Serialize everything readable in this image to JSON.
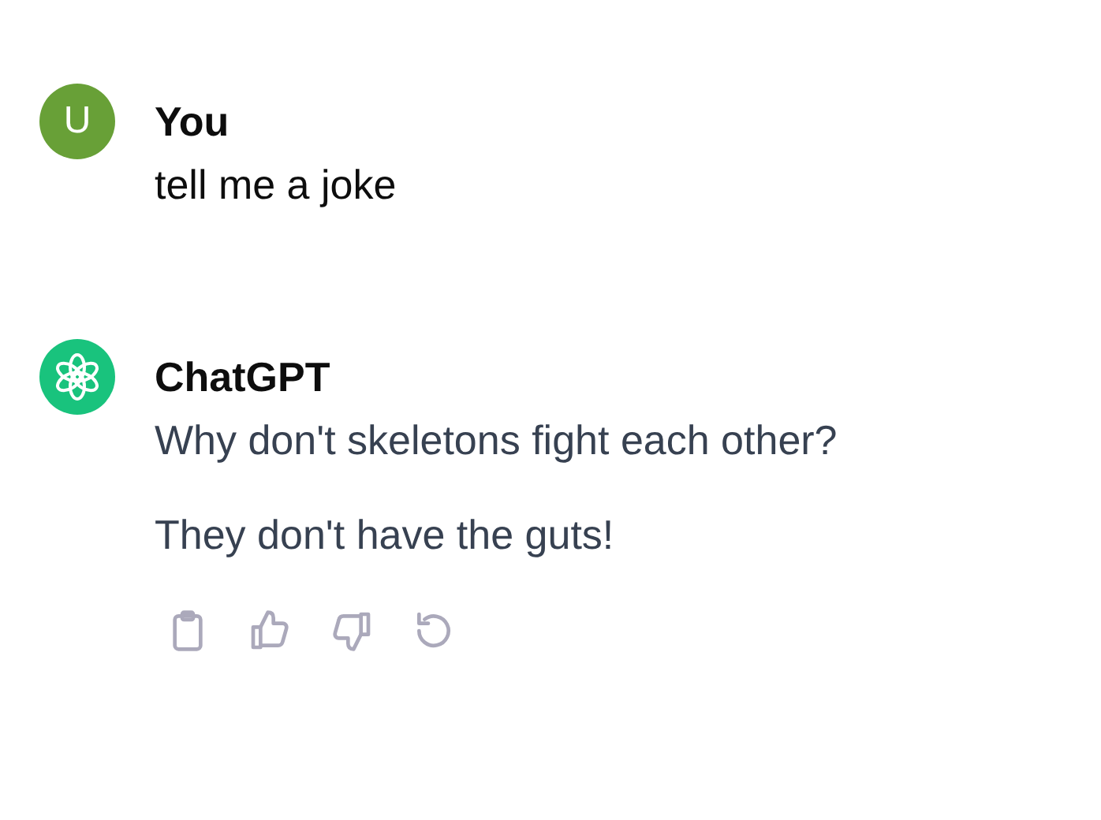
{
  "messages": [
    {
      "kind": "user",
      "avatar": "U",
      "author": "You",
      "paragraphs": [
        "tell me a joke"
      ]
    },
    {
      "kind": "assistant",
      "author": "ChatGPT",
      "paragraphs": [
        "Why don't skeletons fight each other?",
        "They don't have the guts!"
      ],
      "actions": [
        {
          "kind": "copy"
        },
        {
          "kind": "like"
        },
        {
          "kind": "dislike"
        },
        {
          "kind": "regenerate"
        }
      ]
    }
  ]
}
